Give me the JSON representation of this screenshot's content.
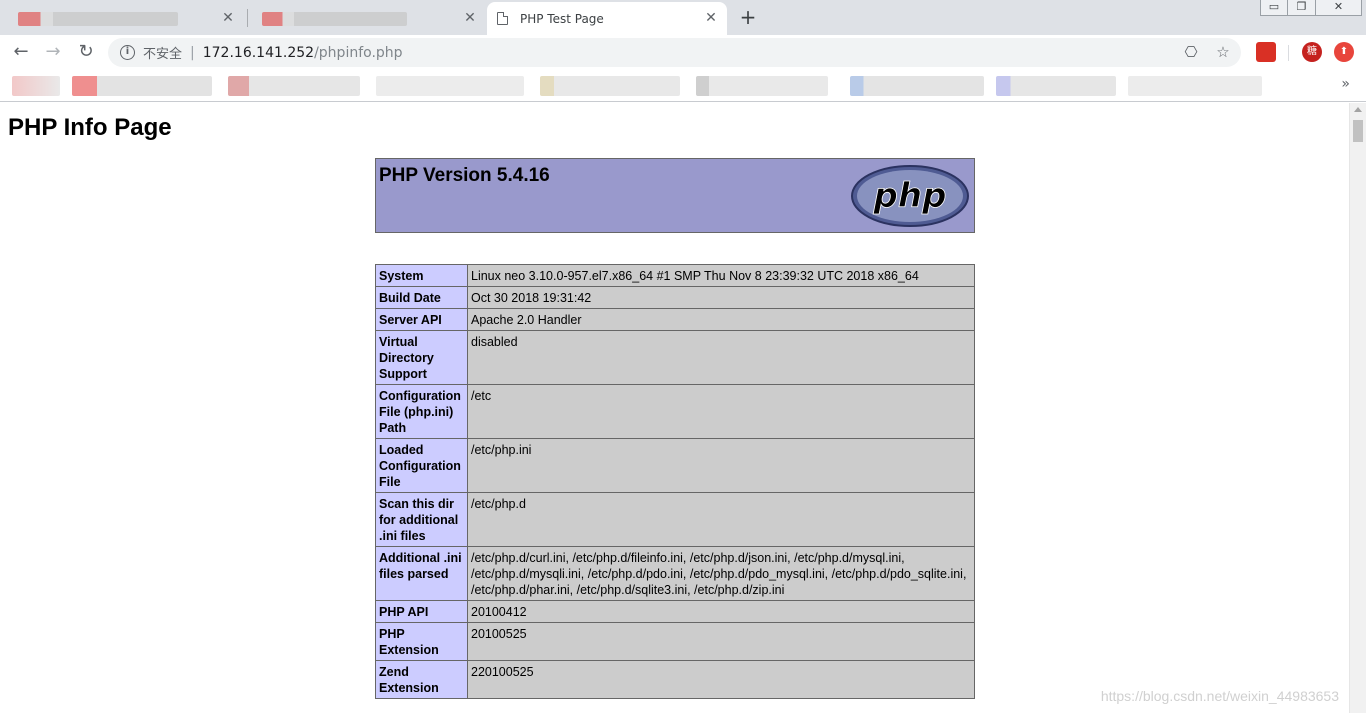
{
  "browser": {
    "tabs": [
      {
        "label": "",
        "blurred": true
      },
      {
        "label": "",
        "blurred": true
      },
      {
        "label": "PHP Test Page",
        "active": true
      }
    ],
    "new_tab_symbol": "+",
    "window_controls": {
      "minimize": "▭",
      "restore": "❐",
      "close": "✕"
    },
    "address": {
      "security_label": "不安全",
      "host": "172.16.141.252",
      "path": "/phpinfo.php"
    },
    "icons": {
      "back": "←",
      "forward": "→",
      "reload": "↻",
      "translate": "⎔",
      "bookmark_star": "☆",
      "bookmarks_more": "»"
    },
    "extensions": [
      {
        "name": "extension-red-square",
        "color": "#d93025"
      },
      {
        "name": "extension-red-circle-text",
        "color": "#c5221f",
        "label": "糖"
      },
      {
        "name": "extension-red-circle-arrow",
        "color": "#e8453c",
        "label": "⬆"
      }
    ]
  },
  "page": {
    "title": "PHP Info Page",
    "version_heading": "PHP Version 5.4.16",
    "logo_text": "php",
    "rows": [
      {
        "label": "System",
        "value": "Linux neo 3.10.0-957.el7.x86_64 #1 SMP Thu Nov 8 23:39:32 UTC 2018 x86_64"
      },
      {
        "label": "Build Date",
        "value": "Oct 30 2018 19:31:42"
      },
      {
        "label": "Server API",
        "value": "Apache 2.0 Handler"
      },
      {
        "label": "Virtual Directory Support",
        "value": "disabled"
      },
      {
        "label": "Configuration File (php.ini) Path",
        "value": "/etc"
      },
      {
        "label": "Loaded Configuration File",
        "value": "/etc/php.ini"
      },
      {
        "label": "Scan this dir for additional .ini files",
        "value": "/etc/php.d"
      },
      {
        "label": "Additional .ini files parsed",
        "value": "/etc/php.d/curl.ini, /etc/php.d/fileinfo.ini, /etc/php.d/json.ini, /etc/php.d/mysql.ini, /etc/php.d/mysqli.ini, /etc/php.d/pdo.ini, /etc/php.d/pdo_mysql.ini, /etc/php.d/pdo_sqlite.ini, /etc/php.d/phar.ini, /etc/php.d/sqlite3.ini, /etc/php.d/zip.ini"
      },
      {
        "label": "PHP API",
        "value": "20100412"
      },
      {
        "label": "PHP Extension",
        "value": "20100525"
      },
      {
        "label": "Zend Extension",
        "value": "220100525"
      }
    ]
  },
  "watermark": "https://blog.csdn.net/weixin_44983653",
  "colors": {
    "php_header": "#9999cc",
    "label_cell": "#ccccff",
    "value_cell": "#cccccc"
  }
}
